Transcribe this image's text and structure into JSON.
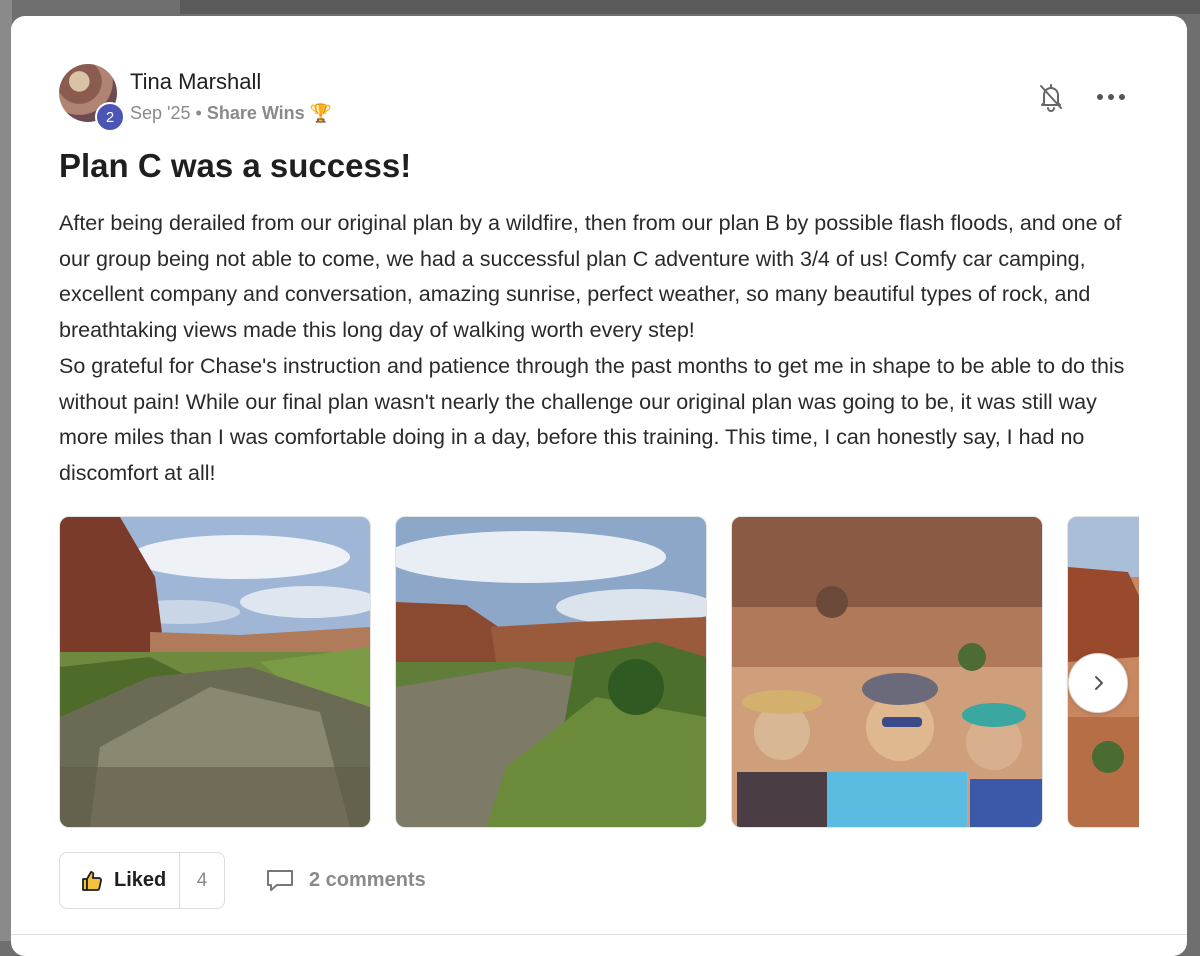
{
  "post": {
    "author": "Tina Marshall",
    "level": "2",
    "date": "Sep '25",
    "separator": "•",
    "category": "Share Wins",
    "category_emoji": "🏆",
    "title": "Plan C was a success!",
    "paragraphs": [
      "After being derailed from our original plan by a wildfire, then from our plan B by possible flash floods, and one of our group being not able to come, we had a successful plan C adventure with 3/4 of us! Comfy car camping, excellent company and conversation, amazing sunrise, perfect weather, so many beautiful types of rock, and breathtaking views made this long day of walking worth every step!",
      "So grateful for Chase's instruction and patience through the past months to get me in shape to be able to do this without pain! While our final plan wasn't nearly the challenge our original plan was going to be, it was still way more miles than I was comfortable doing in a day, before this training. This time, I can honestly say, I had no discomfort at all!"
    ]
  },
  "gallery": {
    "photos": [
      "river-canyon-photo",
      "river-cliffs-photo",
      "hikers-selfie-photo",
      "red-rock-photo"
    ],
    "next_icon": "chevron-right-icon"
  },
  "actions": {
    "like_label": "Liked",
    "like_count": "4",
    "comments_label": "2 comments"
  },
  "icons": {
    "bell": "bell-off-icon",
    "more": "more-horizontal-icon",
    "like": "thumbs-up-icon",
    "comment": "comment-icon"
  },
  "colors": {
    "badge": "#4a55b5",
    "text": "#1f1f1f",
    "muted": "#8a8a8a"
  }
}
